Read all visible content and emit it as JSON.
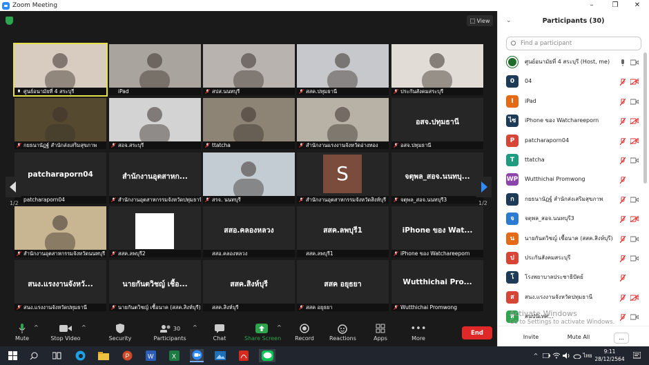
{
  "window": {
    "title": "Zoom Meeting",
    "controls": [
      "–",
      "❐",
      "✕"
    ]
  },
  "stage": {
    "view_label": "View",
    "page_left": "1/2",
    "page_right": "1/2"
  },
  "tiles": [
    {
      "name": "ศูนย์อนามัยที่ 4 สระบุรี",
      "type": "video",
      "bg": "#d8ccc0",
      "active": true,
      "mic": "on"
    },
    {
      "name": "iPad",
      "type": "video",
      "bg": "#a9a49d",
      "mic": "none"
    },
    {
      "name": "สปส.นนทบุรี",
      "type": "video",
      "bg": "#b9b3b0",
      "mic": "muted"
    },
    {
      "name": "สสค.ปทุมธานี",
      "type": "video",
      "bg": "#c6c8cc",
      "mic": "muted"
    },
    {
      "name": "ประกันสังคมสระบุรี",
      "type": "video",
      "bg": "#e1ddd6",
      "mic": "muted"
    },
    {
      "name": "กยธนานัฏฐ์  สำนักส่งเสริมสุขภาพ",
      "type": "video",
      "bg": "#55492f",
      "mic": "muted"
    },
    {
      "name": "สอจ.สระบุรี",
      "type": "video",
      "bg": "#d3d3d3",
      "mic": "muted"
    },
    {
      "name": "ttatcha",
      "type": "video",
      "bg": "#8d8476",
      "mic": "muted"
    },
    {
      "name": "สำนักงานแรงงานจังหวัดอ่างทอง",
      "type": "video",
      "bg": "#b7b1a6",
      "mic": "muted"
    },
    {
      "name": "อสจ.ปทุมธานี",
      "type": "name",
      "big": "อสจ.ปทุมธานี",
      "mic": "muted"
    },
    {
      "name": "patcharaporn04",
      "type": "name",
      "big": "patcharaporn04",
      "mic": "none"
    },
    {
      "name": "สำนักงานอุตสาหกรรมจังหวัดปทุมธานี",
      "type": "name",
      "big": "สำนักงานอุตสาหก...",
      "mic": "muted"
    },
    {
      "name": "สรจ. นนทบุรี",
      "type": "photo",
      "bg": "#c3ccd3",
      "mic": "muted"
    },
    {
      "name": "สำนักงานอุตสาหกรรมจังหวัดสิงห์บุรี",
      "type": "letter",
      "big": "S",
      "mic": "muted"
    },
    {
      "name": "จตุพล_สอจ.นนทบุรี3",
      "type": "name",
      "big": "จตุพล_สอจ.นนทบุ...",
      "mic": "muted"
    },
    {
      "name": "สำนักงานอุตสาหกรรมจังหวัดนนทบุรี",
      "type": "photo",
      "bg": "#c8b693",
      "mic": "muted"
    },
    {
      "name": "สสค.ลพบุรี2",
      "type": "white",
      "mic": "muted"
    },
    {
      "name": "สสอ.คลองหลวง",
      "type": "name",
      "big": "สสอ.คลองหลวง",
      "mic": "none"
    },
    {
      "name": "สสค.ลพบุรี1",
      "type": "name",
      "big": "สสค.ลพบุรี1",
      "mic": "none"
    },
    {
      "name": "iPhone ของ Watchareeporn",
      "type": "name",
      "big": "iPhone ของ Wat...",
      "mic": "muted"
    },
    {
      "name": "สนง.แรงงานจังหวัดปทุมธานี",
      "type": "name",
      "big": "สนง.แรงงานจังหวั...",
      "mic": "muted"
    },
    {
      "name": "นายกันตวิชญ์ เชื้อนาค (สสค.สิงห์บุรี)",
      "type": "name",
      "big": "นายกันตวิชญ์ เชื้อ...",
      "mic": "muted"
    },
    {
      "name": "สสค.สิงห์บุรี",
      "type": "name",
      "big": "สสค.สิงห์บุรี",
      "mic": "none"
    },
    {
      "name": "สสค อยุธยา",
      "type": "name",
      "big": "สสค อยุธยา",
      "mic": "muted"
    },
    {
      "name": "Wutthichai Promwong",
      "type": "name",
      "big": "Wutthichai  Pro...",
      "mic": "muted"
    }
  ],
  "toolbar": {
    "mute": "Mute",
    "stop_video": "Stop Video",
    "security": "Security",
    "participants": "Participants",
    "participants_count": "30",
    "chat": "Chat",
    "share_screen": "Share Screen",
    "record": "Record",
    "reactions": "Reactions",
    "apps": "Apps",
    "more": "More",
    "end": "End",
    "share_color": "#2da44e",
    "end_color": "#e02828"
  },
  "panel": {
    "title": "Participants (30)",
    "search_placeholder": "Find a participant",
    "invite": "Invite",
    "mute_all": "Mute All",
    "more": "...",
    "participants": [
      {
        "name": "ศูนย์อนามัยที่ 4 สระบุรี (Host, me)",
        "avatar": "logo",
        "color": "#1f6b2a",
        "mic": "on",
        "cam": "on"
      },
      {
        "name": "04",
        "avatar": "0",
        "color": "#1d3b57",
        "mic": "muted",
        "cam": "off"
      },
      {
        "name": "iPad",
        "avatar": "I",
        "color": "#e46a18",
        "mic": "muted",
        "cam": "on"
      },
      {
        "name": "iPhone ของ Watchareeporn",
        "avatar": "ไซ",
        "color": "#1d3b57",
        "mic": "muted",
        "cam": "off"
      },
      {
        "name": "patcharaporn04",
        "avatar": "P",
        "color": "#d64535",
        "mic": "muted",
        "cam": "off"
      },
      {
        "name": "ttatcha",
        "avatar": "T",
        "color": "#1f9b80",
        "mic": "muted",
        "cam": "on"
      },
      {
        "name": "Wutthichai Promwong",
        "avatar": "WP",
        "color": "#8e44ad",
        "mic": "muted",
        "cam": "none"
      },
      {
        "name": "กยธนานัฏฐ์  สำนักส่งเสริมสุขภาพ",
        "avatar": "ก",
        "color": "#1d3b57",
        "mic": "muted",
        "cam": "on"
      },
      {
        "name": "จตุพล_สอจ.นนทบุรี3",
        "avatar": "จ",
        "color": "#2b7bd0",
        "mic": "muted",
        "cam": "off"
      },
      {
        "name": "นายกันตวิชญ์ เชื้อนาค (สสค.สิงห์บุรี)",
        "avatar": "น",
        "color": "#e46a18",
        "mic": "muted",
        "cam": "on"
      },
      {
        "name": "ประกันสังคมสระบุรี",
        "avatar": "ป",
        "color": "#d64535",
        "mic": "muted",
        "cam": "on"
      },
      {
        "name": "โรงพยาบาลประชาธิปัตย์",
        "avatar": "โ",
        "color": "#1d3b57",
        "mic": "muted",
        "cam": "none"
      },
      {
        "name": "สนง.แรงงานจังหวัดปทุมธานี",
        "avatar": "ส",
        "color": "#d64535",
        "mic": "muted",
        "cam": "off"
      },
      {
        "name": "สนปนิเทศ...",
        "avatar": "ส",
        "color": "#2da44e",
        "mic": "muted",
        "cam": "on"
      }
    ]
  },
  "watermark": {
    "line1": "Activate Windows",
    "line2": "Go to Settings to activate Windows."
  },
  "taskbar": {
    "time": "9:11",
    "date": "28/12/2564",
    "lang": "ไทย"
  }
}
